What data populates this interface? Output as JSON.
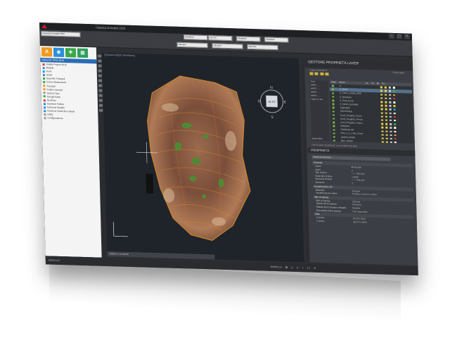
{
  "window": {
    "title": "Classica di Analist 2015",
    "buttons": [
      "–",
      "□",
      "×"
    ]
  },
  "ribbon": {
    "tabs": [
      "Classica di Analist 2015",
      "Standard",
      "ISO-25",
      "Standard",
      "Standard"
    ],
    "selectors": [
      {
        "label": "Standard"
      },
      {
        "label": "ISO-25"
      },
      {
        "label": "Standard"
      },
      {
        "label": "Standard"
      },
      {
        "label": "DaLayer"
      },
      {
        "label": "DaLayer"
      },
      {
        "label": "DaColor"
      }
    ]
  },
  "left_panel": {
    "combo": "Classica di Analist 2015",
    "caption": "ANALIST PRO 2015",
    "tiles": [
      {
        "letter": "A",
        "color": "#f29a1f"
      },
      {
        "letter": "◉",
        "color": "#2a8fd8"
      },
      {
        "letter": "✚",
        "color": "#3aa84a"
      },
      {
        "letter": "▦",
        "color": "#2e9e5c"
      }
    ],
    "tree": [
      {
        "label": "Analist Project 2015",
        "color": "#c44"
      },
      {
        "label": "Modelli",
        "color": "#2a8fd8"
      },
      {
        "label": "Punti",
        "color": "#2a8fd8"
      },
      {
        "label": "Solori",
        "color": "#2a8fd8"
      },
      {
        "label": "Superfici Triangoli",
        "color": "#3aa84a"
      },
      {
        "label": "Curve Sbalzamenti",
        "color": "#3aa84a"
      },
      {
        "label": "Tracciati",
        "color": "#f29a1f"
      },
      {
        "label": "Profili e Sezioni",
        "color": "#f29a1f"
      },
      {
        "label": "Sezioni Tipo",
        "color": "#999"
      },
      {
        "label": "Google Earth",
        "color": "#3aa84a"
      },
      {
        "label": "OnePlan",
        "color": "#c44"
      },
      {
        "label": "Gestione Palline",
        "color": "#2a8fd8"
      },
      {
        "label": "Gestione Modelli",
        "color": "#2a8fd8"
      },
      {
        "label": "Gestione Solidi 3D e Mesh",
        "color": "#2a8fd8"
      },
      {
        "label": "Utility",
        "color": "#999"
      },
      {
        "label": "Configurazione",
        "color": "#999"
      }
    ],
    "bottom_tabs": [
      "Modello",
      "Layout1",
      "Layout2"
    ]
  },
  "viewport": {
    "label": "[-][Superiore][2D Wireframe]",
    "viewcube_top": "ALTO",
    "compass": {
      "n": "N",
      "s": "S",
      "e": "E",
      "w": "O"
    },
    "command_prompt": "Digitare un comando"
  },
  "status_bar": {
    "left": "MODELLO",
    "right_items": [
      "MODELLO",
      "▦",
      "◎",
      "∠",
      "⌖",
      "1:1",
      "⚙"
    ]
  },
  "layer_manager": {
    "title": "GESTORE PROPRIETÀ LAYER",
    "current_layer": "Layer corrente: 0",
    "search_placeholder": "Cerca layer",
    "columns": [
      "Stato",
      "Nome",
      "Ac",
      "Co",
      "Bl",
      "Co..."
    ],
    "filters": [
      "Tutti",
      "ANP1 - ...",
      "ANP2 - ...",
      "ANP3 - ...",
      "ANP4 - ...",
      "Layer in uso"
    ],
    "invert_filter_label": "Inverti filtro",
    "layers": [
      {
        "name": "0",
        "color": "#ffffff",
        "selected": false
      },
      {
        "name": "0_Albert",
        "color": "#3aa84a",
        "selected": true
      },
      {
        "name": "0_Curve_Livello_2015",
        "color": "#f29a1f",
        "selected": false
      },
      {
        "name": "0_Direzione",
        "color": "#d33",
        "selected": false
      },
      {
        "name": "0_Testi_Curve",
        "color": "#ffffff",
        "selected": false
      },
      {
        "name": "0_Vertici_Contrallo",
        "color": "#e5d032",
        "selected": false
      },
      {
        "name": "Capesaldi",
        "color": "#2a8fd8",
        "selected": false
      },
      {
        "name": "CATASTALE",
        "color": "#ffffff",
        "selected": false
      },
      {
        "name": "Curvi_Progetto_Curve",
        "color": "#d33",
        "selected": false
      },
      {
        "name": "Curvi_Progetto_Percor...",
        "color": "#ffffff",
        "selected": false
      },
      {
        "name": "Curvi_Progetto_Tracci...",
        "color": "#3aa84a",
        "selected": false
      },
      {
        "name": "Defpoints",
        "color": "#ffffff",
        "selected": false
      },
      {
        "name": "Fabbricati.dxf",
        "color": "#ffffff",
        "selected": false
      },
      {
        "name": "Foto_1_1_Lotto_Curve",
        "color": "#f29a1f",
        "selected": false
      },
      {
        "name": "LIMITE_PROP",
        "color": "#d33",
        "selected": false
      },
      {
        "name": "Muri_Sistem",
        "color": "#ffffff",
        "selected": false
      }
    ],
    "status_text": "Tutti 32 layer visualizzati / su un totale di 32 layer"
  },
  "properties": {
    "title": "PROPRIETÀ",
    "selection": "Nessuna selezione",
    "sections": [
      {
        "name": "Generale",
        "rows": [
          {
            "k": "Colore",
            "v": "■ DaLayer"
          },
          {
            "k": "Layer",
            "v": "0"
          },
          {
            "k": "Tipo di linea",
            "v": "—— DaLayer"
          },
          {
            "k": "Scala tipo di linea",
            "v": "1.0000"
          },
          {
            "k": "Spessore di linea",
            "v": "—— DaLayer"
          },
          {
            "k": "Spessore",
            "v": "0"
          }
        ]
      },
      {
        "name": "Visualizzazione 3D",
        "rows": [
          {
            "k": "Materiale",
            "v": "DaLayer"
          },
          {
            "k": "Visualizzazione ombre",
            "v": "Proietta e riceve le ombre"
          }
        ]
      },
      {
        "name": "Stile di stampa",
        "rows": [
          {
            "k": "Stile di stampa",
            "v": "DaColor"
          },
          {
            "k": "Tabella stili di stampa",
            "v": "Nessuna"
          },
          {
            "k": "Tabella stili di stampa collegata",
            "v": "Modello"
          },
          {
            "k": "Tipo tabella stili di stampa",
            "v": "Non disponibile"
          }
        ]
      },
      {
        "name": "Vista",
        "rows": [
          {
            "k": "X centro",
            "v": "233373.2630"
          },
          {
            "k": "Y centro",
            "v": "4523773.8678"
          }
        ]
      }
    ]
  }
}
